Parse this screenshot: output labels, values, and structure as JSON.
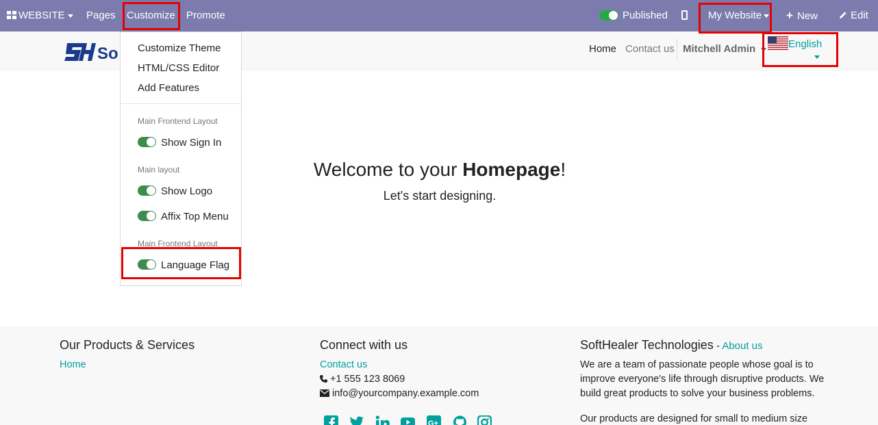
{
  "topbar": {
    "website_label": "WEBSITE",
    "pages_label": "Pages",
    "customize_label": "Customize",
    "promote_label": "Promote",
    "published_label": "Published",
    "my_website_label": "My Website",
    "new_label": "New",
    "edit_label": "Edit",
    "bg_color": "#7c7bad"
  },
  "header": {
    "logo_text": "So",
    "nav_home": "Home",
    "nav_contact": "Contact us",
    "user_name": "Mitchell Admin",
    "language": "English",
    "flag_icon": "us-flag-icon"
  },
  "customize_menu": {
    "items": [
      "Customize Theme",
      "HTML/CSS Editor",
      "Add Features"
    ],
    "section1_header": "Main Frontend Layout",
    "show_sign_in": "Show Sign In",
    "section2_header": "Main layout",
    "show_logo": "Show Logo",
    "affix_top_menu": "Affix Top Menu",
    "section3_header": "Main Frontend Layout",
    "language_flag": "Language Flag"
  },
  "main": {
    "welcome_prefix": "Welcome to your ",
    "welcome_bold": "Homepage",
    "welcome_suffix": "!",
    "subtitle": "Let's start designing."
  },
  "footer": {
    "col1_title": "Our Products & Services",
    "col1_link": "Home",
    "col2_title": "Connect with us",
    "col2_link": "Contact us",
    "phone": "+1 555 123 8069",
    "email": "info@yourcompany.example.com",
    "col3_title": "SoftHealer Technologies",
    "col3_dash": " - ",
    "col3_about": "About us",
    "col3_para1": "We are a team of passionate people whose goal is to improve everyone's life through disruptive products. We build great products to solve your business problems.",
    "col3_para2": "Our products are designed for small to medium size",
    "social_icons": [
      "facebook-icon",
      "twitter-icon",
      "linkedin-icon",
      "youtube-icon",
      "google-plus-icon",
      "github-icon",
      "instagram-icon"
    ],
    "accent_color": "#00a09d"
  }
}
